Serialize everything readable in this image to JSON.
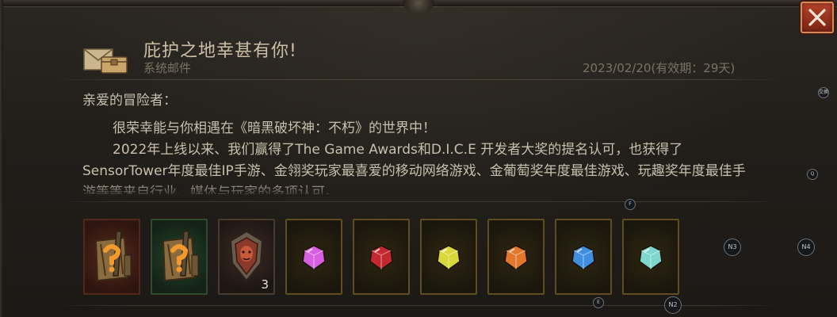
{
  "mail": {
    "title": "庇护之地幸甚有你!",
    "sender": "系统邮件",
    "date": "2023/02/20(有效期：29天)"
  },
  "body": {
    "greeting": "亲爱的冒险者：",
    "paragraph1": "很荣幸能与你相遇在《暗黑破坏神：不朽》的世界中！",
    "paragraph2": "2022年上线以来、我们赢得了The Game Awards和D.I.C.E 开发者大奖的提名认可，也获得了SensorTower年度最佳IP手游、金翎奖玩家最喜爱的移动网络游戏、金葡萄奖年度最佳游戏、玩趣奖年度最佳手游等等来自行业、媒体与玩家的多项认可。"
  },
  "attachments": [
    {
      "kind": "mystery-chest",
      "frame": "red",
      "gem_color": "",
      "quantity": ""
    },
    {
      "kind": "mystery-chest",
      "frame": "green",
      "gem_color": "",
      "quantity": ""
    },
    {
      "kind": "crest",
      "frame": "dark",
      "gem_color": "",
      "quantity": "3"
    },
    {
      "kind": "gem",
      "frame": "gold",
      "gem_color": "#d85fe0",
      "quantity": ""
    },
    {
      "kind": "gem",
      "frame": "gold",
      "gem_color": "#c3282e",
      "quantity": ""
    },
    {
      "kind": "gem",
      "frame": "gold",
      "gem_color": "#d9d83a",
      "quantity": ""
    },
    {
      "kind": "gem",
      "frame": "gold",
      "gem_color": "#e2762a",
      "quantity": ""
    },
    {
      "kind": "gem",
      "frame": "gold",
      "gem_color": "#3f8ee0",
      "quantity": ""
    },
    {
      "kind": "gem",
      "frame": "gold",
      "gem_color": "#7fd6cf",
      "quantity": ""
    }
  ],
  "controller_hints": {
    "hint_a": "交换",
    "hint_q": "Q",
    "hint_f": "F",
    "hint_n3": "N3",
    "hint_n4": "N4",
    "hint_e": "E",
    "hint_n2": "N2"
  },
  "colors": {
    "close_button": "#a83a24",
    "title_text": "#cbbfa7",
    "secondary_text": "#7a7265",
    "body_text": "#c9bfae"
  }
}
